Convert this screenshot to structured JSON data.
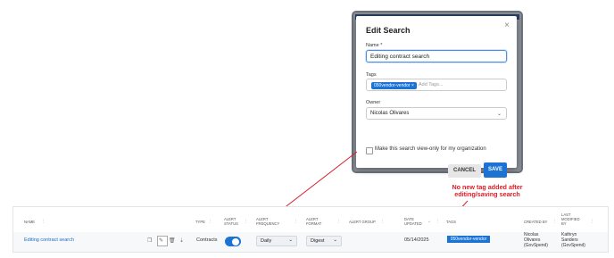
{
  "modal": {
    "title": "Edit Search",
    "close": "×",
    "name_label": "Name *",
    "name_value": "Editing contract search",
    "tags_label": "Tags",
    "tag_chip": "050vendor-vendor ×",
    "tags_placeholder": "Add Tags...",
    "owner_label": "Owner",
    "owner_value": "Nicolas Olivares",
    "checkbox_label": "Make this search view-only for my organization",
    "cancel": "CANCEL",
    "save": "SAVE"
  },
  "annotation": "No new tag added after editing/saving search",
  "table": {
    "headers": {
      "name": "NAME",
      "type": "TYPE",
      "alert_status": "ALERT STATUS",
      "alert_frequency": "ALERT FREQUENCY",
      "alert_format": "ALERT FORMAT",
      "alert_group": "ALERT GROUP",
      "date_updated": "DATE UPDATED",
      "tags": "TAGS",
      "created_by": "CREATED BY",
      "last_modified_by": "LAST MODIFIED BY"
    },
    "row": {
      "name": "Editing contract search",
      "type": "Contracts",
      "frequency": "Daily",
      "format": "Digest",
      "date": "05/14/2025",
      "tag": "050vendor-vendor",
      "created_by": "Nicolas Olivares (GovSpend)",
      "modified_by": "Kathryn Sanders (GovSpend)"
    }
  },
  "colors": {
    "primary": "#1b73d4",
    "annotation": "#d8202a"
  },
  "icons": [
    "copy-icon",
    "edit-icon",
    "delete-icon",
    "download-icon",
    "chevron-down-icon",
    "close-icon"
  ]
}
